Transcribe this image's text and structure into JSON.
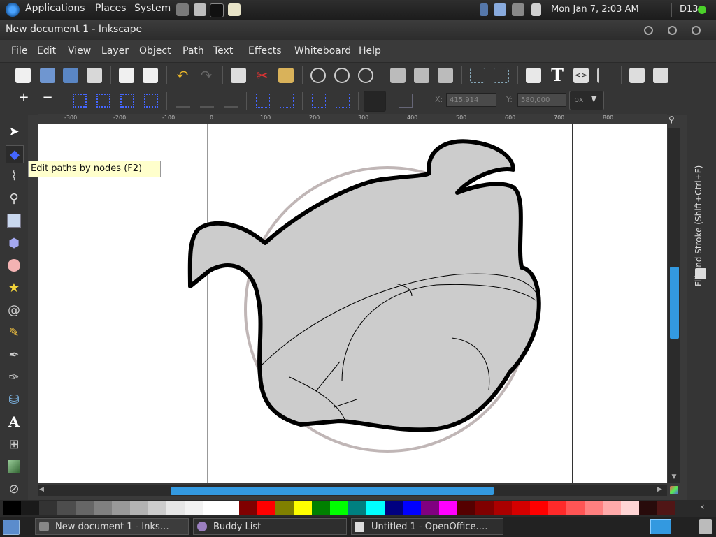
{
  "top_panel": {
    "menus": [
      "Applications",
      "Places",
      "System"
    ],
    "clock": "Mon Jan  7,  2:03 AM",
    "workspace": "D13"
  },
  "window": {
    "title": "New document 1 - Inkscape"
  },
  "menubar": {
    "items": [
      "File",
      "Edit",
      "View",
      "Layer",
      "Object",
      "Path",
      "Text",
      "Effects",
      "Whiteboard",
      "Help"
    ]
  },
  "controls": {
    "x_label": "X:",
    "x_value": "415,914",
    "y_label": "Y:",
    "y_value": "580,000",
    "unit": "px"
  },
  "ruler": {
    "labels": [
      "-300",
      "-200",
      "-100",
      "0",
      "100",
      "200",
      "300",
      "400",
      "500",
      "600",
      "700",
      "800"
    ]
  },
  "tooltip": "Edit paths by nodes (F2)",
  "dock": {
    "label": "Fill and Stroke (Shift+Ctrl+F)"
  },
  "palette": {
    "colors": [
      "#000000",
      "#1a1a1a",
      "#333333",
      "#4d4d4d",
      "#666666",
      "#808080",
      "#999999",
      "#b3b3b3",
      "#cccccc",
      "#e6e6e6",
      "#f2f2f2",
      "#ffffff",
      "#ffffff",
      "#800000",
      "#ff0000",
      "#808000",
      "#ffff00",
      "#008000",
      "#00ff00",
      "#008080",
      "#00ffff",
      "#000080",
      "#0000ff",
      "#800080",
      "#ff00ff",
      "#550000",
      "#800000",
      "#aa0000",
      "#d40000",
      "#ff0000",
      "#ff2a2a",
      "#ff5555",
      "#ff8080",
      "#ffaaaa",
      "#ffd5d5",
      "#280b0b",
      "#501616"
    ]
  },
  "taskbar": {
    "tasks": [
      "New document 1 - Inks…",
      "Buddy List",
      "Untitled 1 - OpenOffice.…"
    ]
  },
  "colors": {
    "accent": "#3399e0",
    "shape_fill": "#cccccc",
    "shape_stroke": "#000000",
    "circle_stroke": "#c0b6b6"
  }
}
